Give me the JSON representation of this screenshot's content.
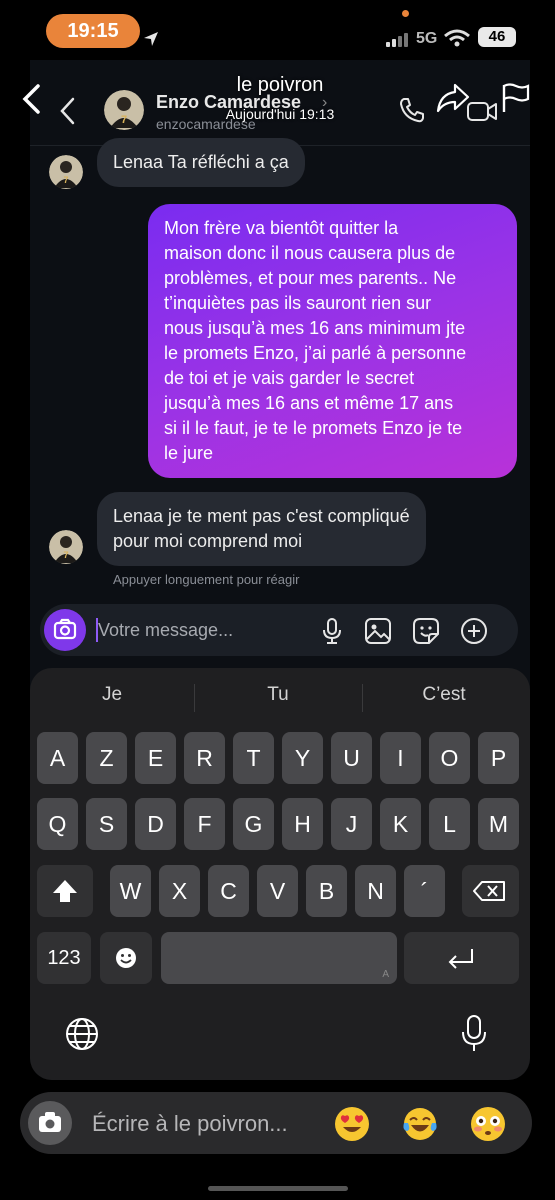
{
  "status_bar": {
    "time": "19:15",
    "network": "5G",
    "battery": "46",
    "accent_color": "#e9843a"
  },
  "overlay_header": {
    "title": "le poivron",
    "subtitle": "Aujourd'hui 19:13"
  },
  "conversation": {
    "contact_name": "Enzo Camardese",
    "username": "enzocamardese",
    "chevron": "›",
    "messages": [
      {
        "direction": "incoming",
        "lines": [
          "Lenaa Ta réfléchi a ça"
        ]
      },
      {
        "direction": "outgoing",
        "lines": [
          "Mon frère va bientôt quitter la",
          "maison donc il nous causera plus de",
          "problèmes, et pour mes parents.. Ne",
          "t’inquiètes pas ils sauront rien sur",
          "nous jusqu’à mes 16 ans minimum jte",
          "le promets Enzo, j’ai parlé à personne",
          "de toi et je vais garder le secret",
          "jusqu’à mes 16 ans et même 17 ans",
          "si il le faut, je te le promets Enzo je te",
          "le jure"
        ]
      },
      {
        "direction": "incoming",
        "lines": [
          "Lenaa je te ment pas c'est compliqué",
          "pour moi comprend moi"
        ]
      }
    ],
    "reaction_hint": "Appuyer longuement pour réagir",
    "composer_placeholder": "Votre message...",
    "outgoing_colors": [
      "#7a2cf0",
      "#b832d8"
    ]
  },
  "keyboard": {
    "suggestions": [
      "Je",
      "Tu",
      "C’est"
    ],
    "row1": [
      "A",
      "Z",
      "E",
      "R",
      "T",
      "Y",
      "U",
      "I",
      "O",
      "P"
    ],
    "row2": [
      "Q",
      "S",
      "D",
      "F",
      "G",
      "H",
      "J",
      "K",
      "L",
      "M"
    ],
    "row3": [
      "W",
      "X",
      "C",
      "V",
      "B",
      "N",
      "´"
    ],
    "numbers_label": "123",
    "space_mark": "A"
  },
  "reply_bar": {
    "placeholder": "Écrire à le poivron...",
    "emojis": [
      "heart-eyes-emoji",
      "tears-of-joy-emoji",
      "flushed-emoji"
    ]
  }
}
